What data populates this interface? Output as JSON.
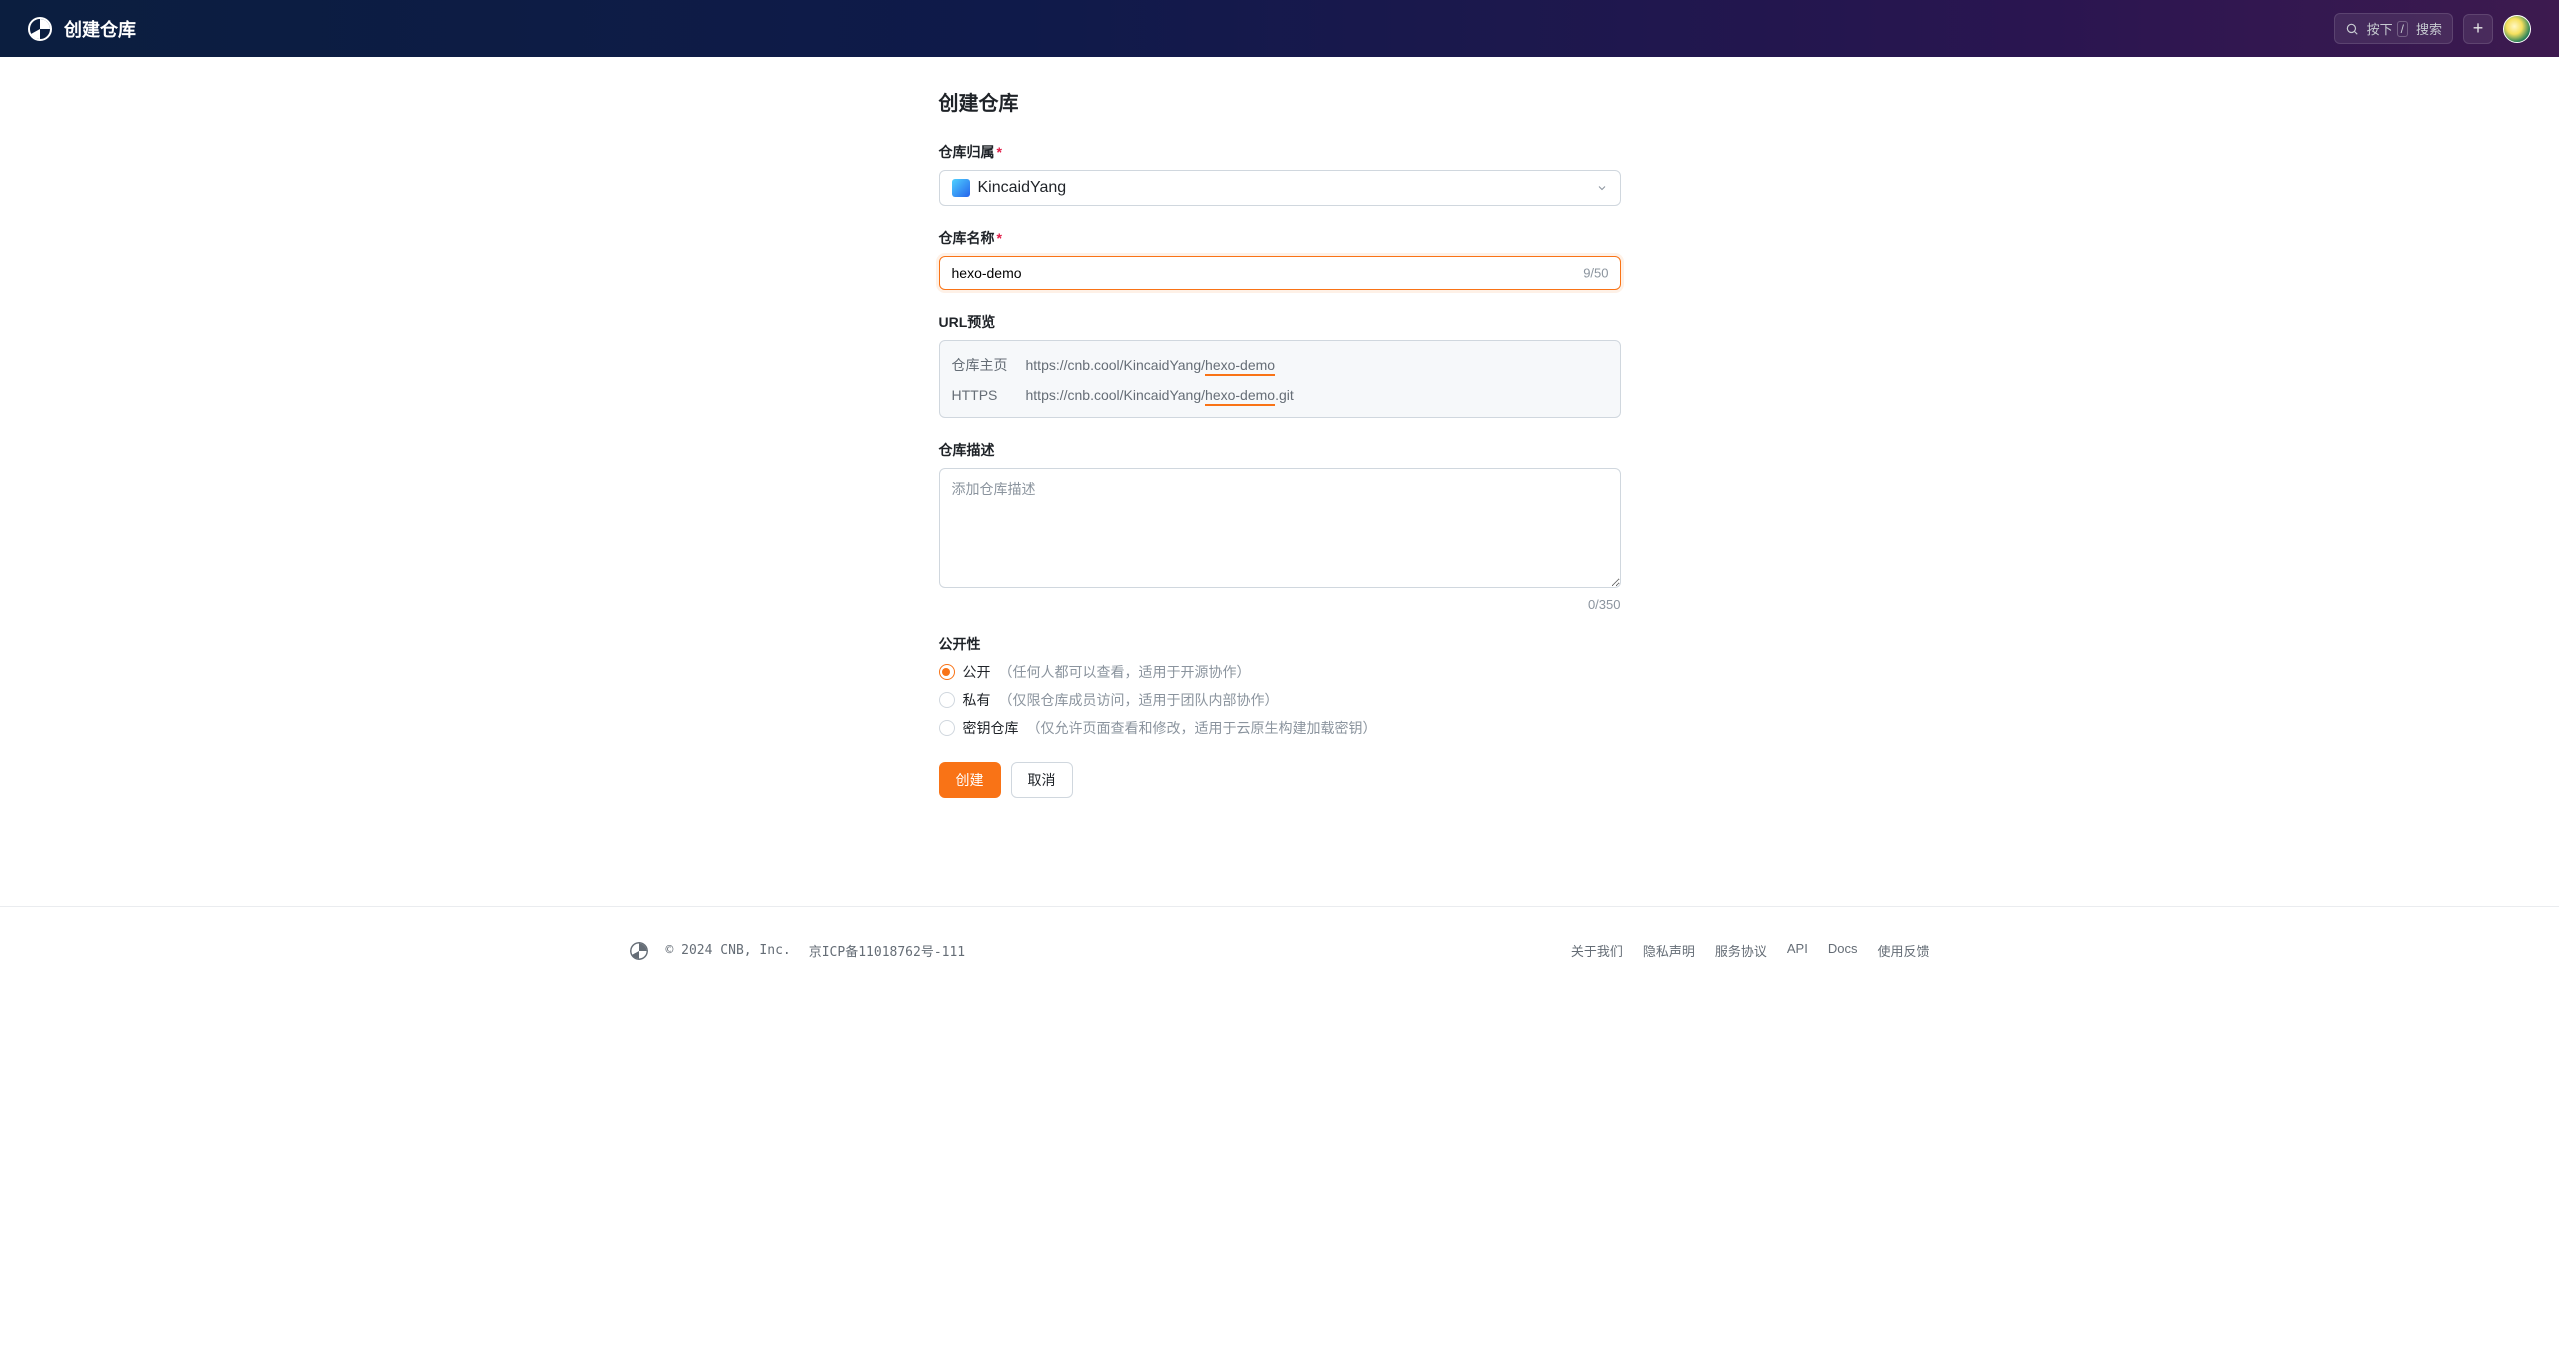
{
  "header": {
    "title": "创建仓库",
    "search_hint_press": "按下",
    "search_hint_slash": "/",
    "search_text": "搜索"
  },
  "page": {
    "title": "创建仓库"
  },
  "form": {
    "owner_label": "仓库归属",
    "owner_value": "KincaidYang",
    "name_label": "仓库名称",
    "name_value": "hexo-demo",
    "name_counter": "9/50",
    "url_preview_label": "URL预览",
    "url_home_label": "仓库主页",
    "url_home_prefix": "https://cnb.cool/KincaidYang/",
    "url_home_slug": "hexo-demo",
    "url_home_suffix": "",
    "url_https_label": "HTTPS",
    "url_https_prefix": "https://cnb.cool/KincaidYang/",
    "url_https_slug": "hexo-demo",
    "url_https_suffix": ".git",
    "desc_label": "仓库描述",
    "desc_placeholder": "添加仓库描述",
    "desc_counter": "0/350",
    "visibility_label": "公开性",
    "visibility": [
      {
        "label": "公开",
        "desc": "（任何人都可以查看，适用于开源协作）",
        "checked": true
      },
      {
        "label": "私有",
        "desc": "（仅限仓库成员访问，适用于团队内部协作）",
        "checked": false
      },
      {
        "label": "密钥仓库",
        "desc": "（仅允许页面查看和修改，适用于云原生构建加载密钥）",
        "checked": false
      }
    ],
    "create_btn": "创建",
    "cancel_btn": "取消"
  },
  "footer": {
    "copyright": "© 2024 CNB, Inc.",
    "icp": "京ICP备11018762号-111",
    "links": [
      "关于我们",
      "隐私声明",
      "服务协议",
      "API",
      "Docs",
      "使用反馈"
    ]
  }
}
